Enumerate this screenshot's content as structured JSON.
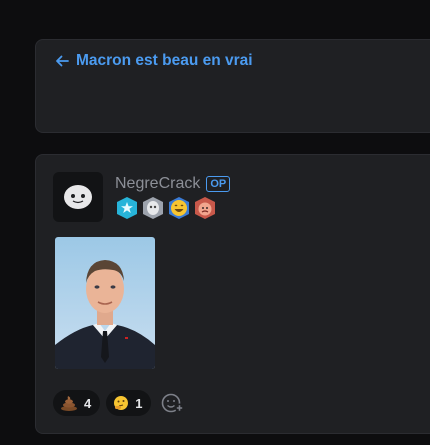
{
  "thread": {
    "back_icon": "arrow-left-icon",
    "title": "Macron est beau en vrai"
  },
  "post": {
    "author": "NegreCrack",
    "op_label": "OP",
    "badges": [
      "teal-star-badge",
      "ghost-badge",
      "laughing-emoji-badge",
      "red-face-badge"
    ],
    "reactions": [
      {
        "icon": "poop-emoji-icon",
        "count": "4"
      },
      {
        "icon": "thinking-emoji-icon",
        "count": "1"
      }
    ],
    "add_reaction_icon": "add-reaction-icon"
  },
  "colors": {
    "accent": "#4b9bf0",
    "card": "#1f2023",
    "background": "#0d0d0f"
  }
}
